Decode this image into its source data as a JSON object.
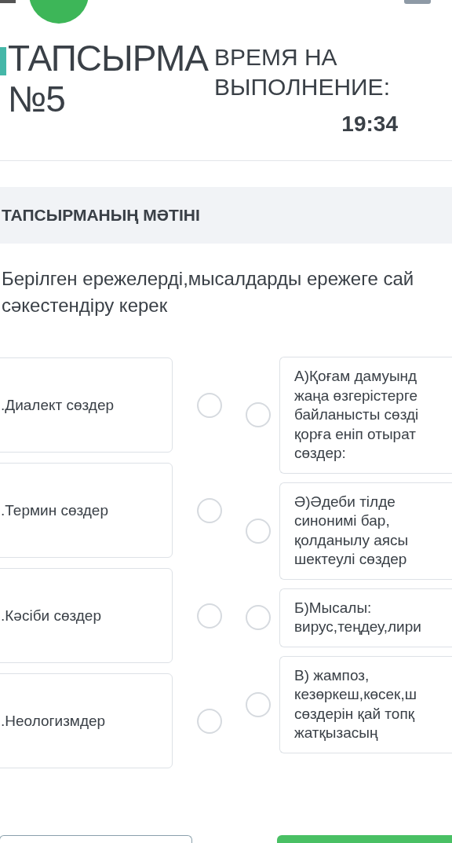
{
  "header": {
    "title": "ТАПСЫРМА\n№5",
    "time_label": "ВРЕМЯ НА\nВЫПОЛНЕНИЕ:",
    "time": "19:34"
  },
  "section": {
    "title": "ТАПСЫРМАНЫҢ МӘТІНІ"
  },
  "instruction": "Берілген ережелерді,мысалдарды ережеге сай\nсәкестендіру керек",
  "left_items": [
    {
      "label": ".Диалект сөздер",
      "selected": false
    },
    {
      "label": ".Термин сөздер",
      "selected": false
    },
    {
      "label": ".Кәсіби сөздер",
      "selected": false
    },
    {
      "label": ".Неологизмдер",
      "selected": false
    }
  ],
  "right_items": [
    {
      "lines": [
        "А)Қоғам дамуынд",
        "жаңа өзгерістерге",
        "байланысты сөзді",
        "қорға еніп отырат",
        "сөздер:"
      ],
      "selected": false
    },
    {
      "lines": [
        "Ә)Әдеби тілде",
        "синонимі бар,",
        "қолданылу аясы",
        "шектеулі сөздер"
      ],
      "selected": false
    },
    {
      "lines": [
        "Б)Мысалы:",
        "вирус,теңдеу,лири"
      ],
      "selected": false
    },
    {
      "lines": [
        "В) жампоз,",
        "кезөркеш,көсек,ш",
        "сөздерін қай топқ",
        "жатқызасың"
      ],
      "selected": false
    }
  ]
}
